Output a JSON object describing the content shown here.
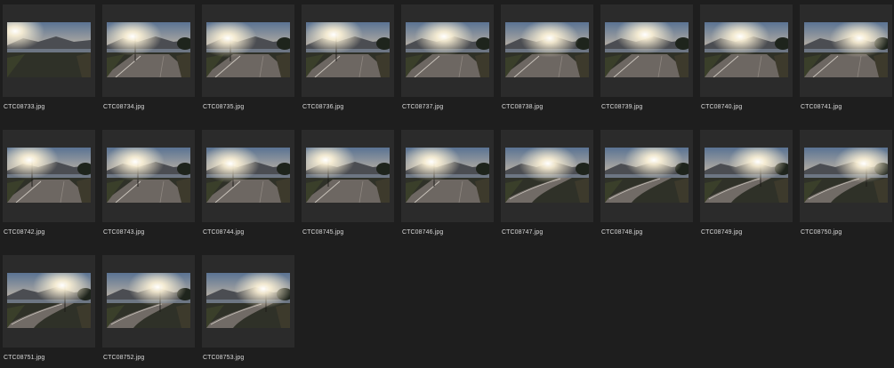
{
  "browser": {
    "files": [
      {
        "name": "CTC08733.jpg",
        "scene": "coast"
      },
      {
        "name": "CTC08734.jpg",
        "scene": "road-left"
      },
      {
        "name": "CTC08735.jpg",
        "scene": "road-left"
      },
      {
        "name": "CTC08736.jpg",
        "scene": "road-left"
      },
      {
        "name": "CTC08737.jpg",
        "scene": "road-center"
      },
      {
        "name": "CTC08738.jpg",
        "scene": "road-center"
      },
      {
        "name": "CTC08739.jpg",
        "scene": "road-center"
      },
      {
        "name": "CTC08740.jpg",
        "scene": "road-center"
      },
      {
        "name": "CTC08741.jpg",
        "scene": "road-right"
      },
      {
        "name": "CTC08742.jpg",
        "scene": "road-left"
      },
      {
        "name": "CTC08743.jpg",
        "scene": "road-left"
      },
      {
        "name": "CTC08744.jpg",
        "scene": "road-left"
      },
      {
        "name": "CTC08745.jpg",
        "scene": "road-left"
      },
      {
        "name": "CTC08746.jpg",
        "scene": "road-left"
      },
      {
        "name": "CTC08747.jpg",
        "scene": "curve"
      },
      {
        "name": "CTC08748.jpg",
        "scene": "curve"
      },
      {
        "name": "CTC08749.jpg",
        "scene": "curve-pole"
      },
      {
        "name": "CTC08750.jpg",
        "scene": "curve-pole"
      },
      {
        "name": "CTC08751.jpg",
        "scene": "curve-pole"
      },
      {
        "name": "CTC08752.jpg",
        "scene": "curve-pole"
      },
      {
        "name": "CTC08753.jpg",
        "scene": "curve-pole"
      }
    ],
    "colors": {
      "background": "#1e1e1e",
      "tile": "#2b2b2b",
      "label": "#d8d8d8"
    }
  }
}
